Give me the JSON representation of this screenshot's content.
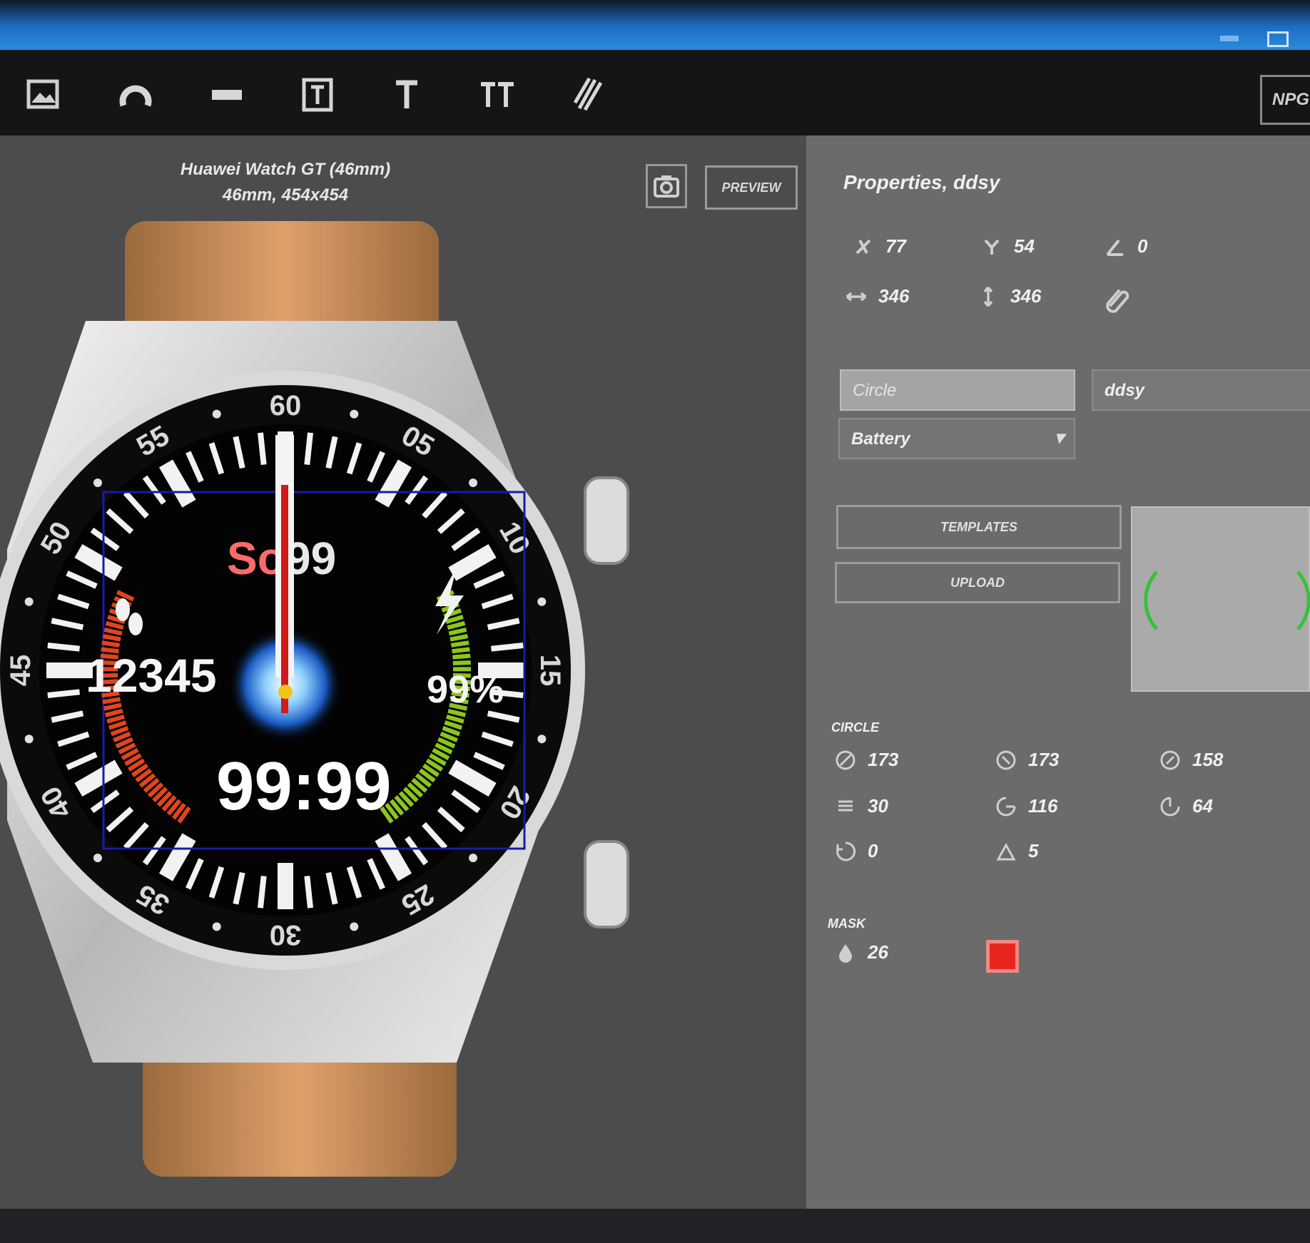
{
  "toolbar": {
    "tools": [
      {
        "name": "image-tool",
        "icon": "image-icon"
      },
      {
        "name": "arc-tool",
        "icon": "arc-icon"
      },
      {
        "name": "rect-tool",
        "icon": "rect-icon"
      },
      {
        "name": "text-box-tool",
        "icon": "text-box-icon"
      },
      {
        "name": "text-tool",
        "icon": "text-icon"
      },
      {
        "name": "text-pair-tool",
        "icon": "text-pair-icon"
      },
      {
        "name": "hands-tool",
        "icon": "slash-icon"
      }
    ],
    "right_button_label": "NPG"
  },
  "device": {
    "name": "Huawei Watch GT (46mm)",
    "spec": "46mm, 454x454"
  },
  "canvas_buttons": {
    "preview_label": "PREVIEW"
  },
  "watch_face": {
    "bezel_numbers": [
      "60",
      "05",
      "10",
      "15",
      "20",
      "25",
      "30",
      "35",
      "40",
      "45",
      "50",
      "55"
    ],
    "top_text": "So",
    "top_value": "99",
    "steps": "12345",
    "battery": "99%",
    "time": "99:99",
    "colors": {
      "steps_arc": "#e2451c",
      "battery_arc": "#8cc61a",
      "hand": "#d21a1a",
      "frame": "#1a1aa8"
    },
    "battery_level": 0.99
  },
  "properties": {
    "title": "Properties, ddsy",
    "x": "77",
    "y": "54",
    "angle": "0",
    "width": "346",
    "height": "346",
    "circle_field": "Circle",
    "id_field": "ddsy",
    "source_select": "Battery",
    "templates_label": "TEMPLATES",
    "upload_label": "UPLOAD",
    "circle_section": "CIRCLE",
    "circle_props": [
      {
        "icon": "diameter-icon",
        "value": "173"
      },
      {
        "icon": "diameter-alt-icon",
        "value": "173"
      },
      {
        "icon": "inner-diameter-icon",
        "value": "158"
      },
      {
        "icon": "segments-icon",
        "value": "30"
      },
      {
        "icon": "start-angle-icon",
        "value": "116"
      },
      {
        "icon": "end-angle-icon",
        "value": "64"
      },
      {
        "icon": "rotation-icon",
        "value": "0"
      },
      {
        "icon": "step-icon",
        "value": "5"
      }
    ],
    "mask_section": "MASK",
    "mask_opacity": "26",
    "mask_color": "#e8261e"
  }
}
